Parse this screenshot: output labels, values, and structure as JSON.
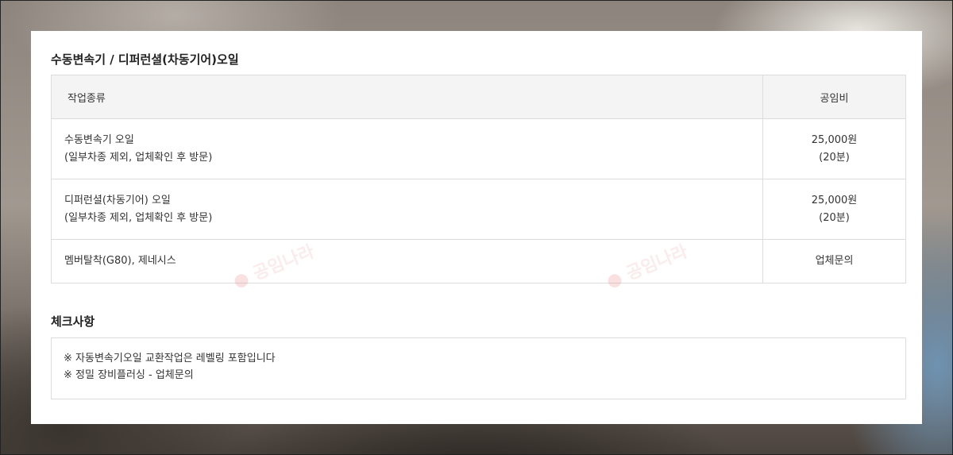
{
  "section": {
    "title": "수동변속기 / 디퍼런셜(차동기어)오일"
  },
  "table": {
    "headers": [
      "작업종류",
      "공임비"
    ],
    "rows": [
      {
        "type_line1": "수동변속기 오일",
        "type_line2": "(일부차종 제외, 업체확인 후 방문)",
        "price_line1": "25,000원",
        "price_line2": "(20분)"
      },
      {
        "type_line1": "디퍼런셜(차동기어) 오일",
        "type_line2": "(일부차종 제외, 업체확인 후 방문)",
        "price_line1": "25,000원",
        "price_line2": "(20분)"
      },
      {
        "type_line1": "멤버탈착(G80), 제네시스",
        "price_line1": "업체문의"
      }
    ]
  },
  "check": {
    "title": "체크사항",
    "notes": [
      "※ 자동변속기오일 교환작업은 레벨링 포함입니다",
      "※ 정밀 장비플러싱 - 업체문의"
    ]
  },
  "watermark": {
    "text": "공임나라"
  }
}
